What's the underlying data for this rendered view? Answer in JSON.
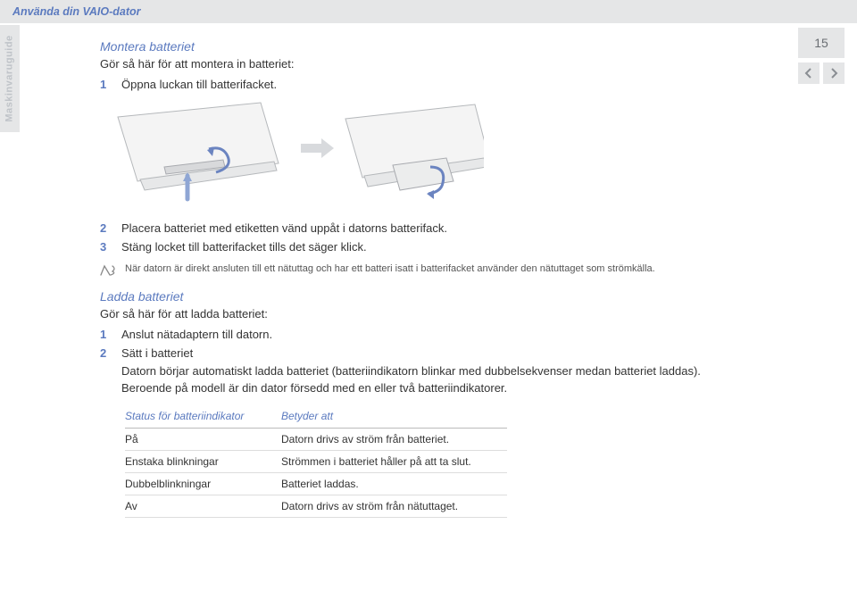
{
  "header": {
    "title": "Använda din VAIO-dator",
    "side_tab": "Maskinvaruguide",
    "page_number": "15"
  },
  "section1": {
    "title": "Montera batteriet",
    "intro": "Gör så här för att montera in batteriet:",
    "step1_num": "1",
    "step1_text": "Öppna luckan till batterifacket.",
    "step2_num": "2",
    "step2_text": "Placera batteriet med etiketten vänd uppåt i datorns batterifack.",
    "step3_num": "3",
    "step3_text": "Stäng locket till batterifacket tills det säger klick.",
    "note": "När datorn är direkt ansluten till ett nätuttag och har ett batteri isatt i batterifacket använder den nätuttaget som strömkälla."
  },
  "section2": {
    "title": "Ladda batteriet",
    "intro": "Gör så här för att ladda batteriet:",
    "step1_num": "1",
    "step1_text": "Anslut nätadaptern till datorn.",
    "step2_num": "2",
    "step2_head": "Sätt i batteriet",
    "step2_p1": "Datorn börjar automatiskt ladda batteriet (batteriindikatorn blinkar med dubbelsekvenser medan batteriet laddas).",
    "step2_p2": "Beroende på modell är din dator försedd med en eller två batteriindikatorer."
  },
  "table": {
    "header_status": "Status för batteriindikator",
    "header_meaning": "Betyder att",
    "rows": [
      {
        "status": "På",
        "meaning": "Datorn drivs av ström från batteriet."
      },
      {
        "status": "Enstaka blinkningar",
        "meaning": "Strömmen i batteriet håller på att ta slut."
      },
      {
        "status": "Dubbelblinkningar",
        "meaning": "Batteriet laddas."
      },
      {
        "status": "Av",
        "meaning": "Datorn drivs av ström från nätuttaget."
      }
    ]
  }
}
